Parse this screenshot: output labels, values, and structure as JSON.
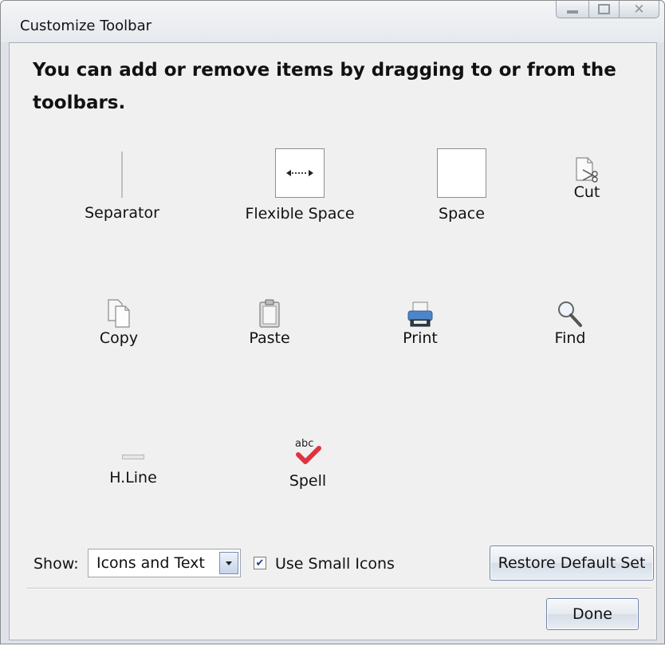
{
  "window": {
    "title": "Customize Toolbar",
    "controls": [
      "minimize-icon",
      "maximize-icon",
      "close-icon"
    ]
  },
  "instructions": "You can add or remove items by dragging to or from the toolbars.",
  "palette": {
    "items": [
      {
        "label": "Separator",
        "icon": "separator-icon"
      },
      {
        "label": "Flexible Space",
        "icon": "flexible-space-icon"
      },
      {
        "label": "Space",
        "icon": "space-icon"
      },
      {
        "label": "Cut",
        "icon": "scissors-icon"
      },
      {
        "label": "Copy",
        "icon": "copy-icon"
      },
      {
        "label": "Paste",
        "icon": "clipboard-icon"
      },
      {
        "label": "Print",
        "icon": "printer-icon"
      },
      {
        "label": "Find",
        "icon": "magnifier-icon"
      },
      {
        "label": "H.Line",
        "icon": "horizontal-line-icon"
      },
      {
        "label": "Spell",
        "icon": "spellcheck-icon"
      }
    ]
  },
  "spell_icon_text": "abc",
  "show": {
    "label": "Show:",
    "selected": "Icons and Text"
  },
  "small_icons": {
    "label": "Use Small Icons",
    "checked": true
  },
  "buttons": {
    "restore": "Restore Default Set",
    "done": "Done"
  },
  "colors": {
    "window_bg": "#f0f0f0",
    "frame": "#dfe3e8",
    "button_border": "#6f84a8",
    "checkmark": "#1b3f91",
    "spell_check_red": "#e0333d"
  }
}
